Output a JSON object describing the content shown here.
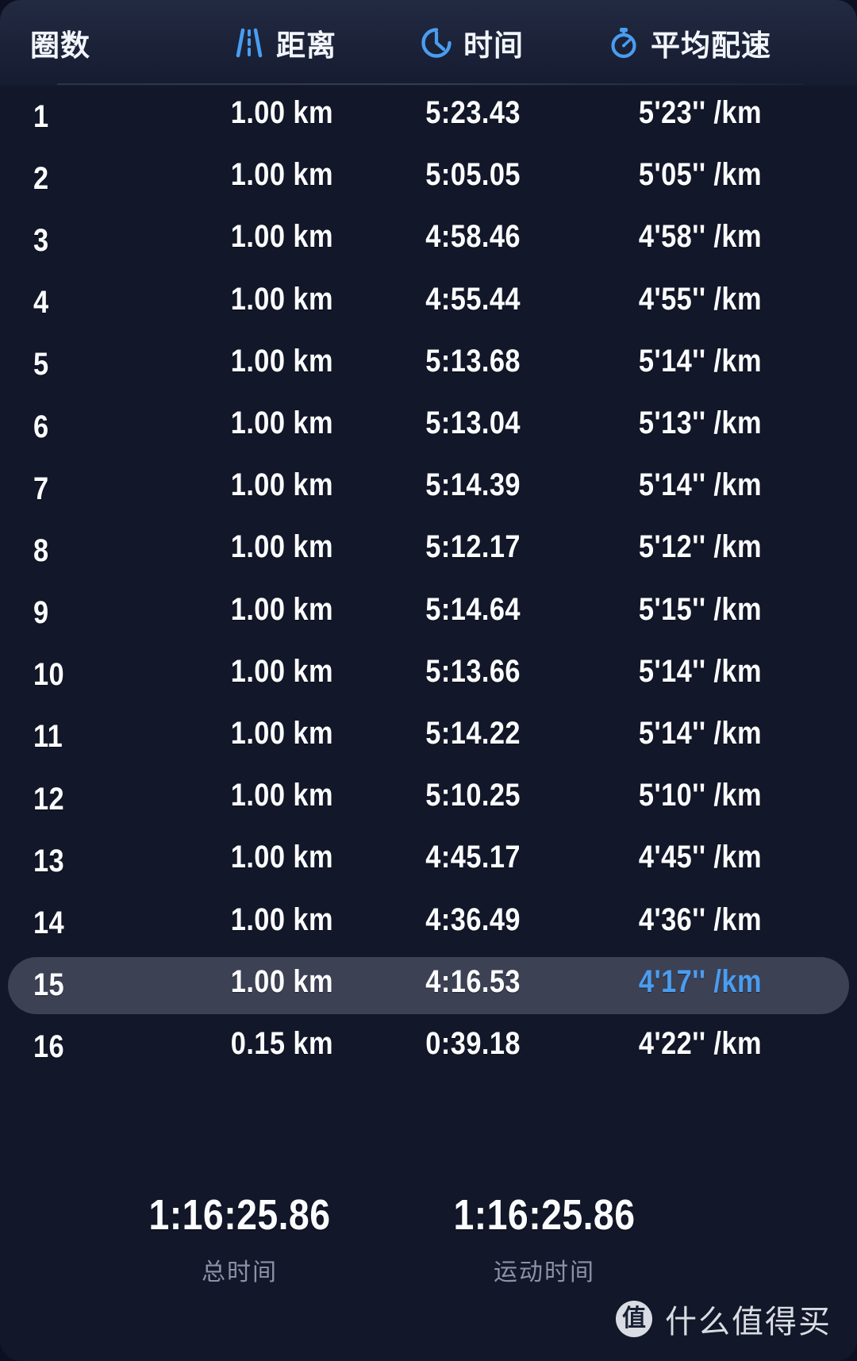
{
  "theme": {
    "background": "#121729",
    "header_gradient_top": "#222a42",
    "text_primary": "#fbfcfe",
    "text_muted": "#8a93a8",
    "accent": "#4a9df0",
    "highlight_row_bg": "#3d4154"
  },
  "header": {
    "columns": [
      {
        "label": "圈数",
        "icon": ""
      },
      {
        "label": "距离",
        "icon": "road-lane-icon"
      },
      {
        "label": "时间",
        "icon": "clock-icon"
      },
      {
        "label": "平均配速",
        "icon": "stopwatch-icon"
      }
    ]
  },
  "table": {
    "column_keys": [
      "lap",
      "distance",
      "time",
      "avg_pace"
    ],
    "rows": [
      {
        "lap": "1",
        "distance": "1.00 km",
        "time": "5:23.43",
        "avg_pace": "5'23'' /km",
        "highlighted": false
      },
      {
        "lap": "2",
        "distance": "1.00 km",
        "time": "5:05.05",
        "avg_pace": "5'05'' /km",
        "highlighted": false
      },
      {
        "lap": "3",
        "distance": "1.00 km",
        "time": "4:58.46",
        "avg_pace": "4'58'' /km",
        "highlighted": false
      },
      {
        "lap": "4",
        "distance": "1.00 km",
        "time": "4:55.44",
        "avg_pace": "4'55'' /km",
        "highlighted": false
      },
      {
        "lap": "5",
        "distance": "1.00 km",
        "time": "5:13.68",
        "avg_pace": "5'14'' /km",
        "highlighted": false
      },
      {
        "lap": "6",
        "distance": "1.00 km",
        "time": "5:13.04",
        "avg_pace": "5'13'' /km",
        "highlighted": false
      },
      {
        "lap": "7",
        "distance": "1.00 km",
        "time": "5:14.39",
        "avg_pace": "5'14'' /km",
        "highlighted": false
      },
      {
        "lap": "8",
        "distance": "1.00 km",
        "time": "5:12.17",
        "avg_pace": "5'12'' /km",
        "highlighted": false
      },
      {
        "lap": "9",
        "distance": "1.00 km",
        "time": "5:14.64",
        "avg_pace": "5'15'' /km",
        "highlighted": false
      },
      {
        "lap": "10",
        "distance": "1.00 km",
        "time": "5:13.66",
        "avg_pace": "5'14'' /km",
        "highlighted": false
      },
      {
        "lap": "11",
        "distance": "1.00 km",
        "time": "5:14.22",
        "avg_pace": "5'14'' /km",
        "highlighted": false
      },
      {
        "lap": "12",
        "distance": "1.00 km",
        "time": "5:10.25",
        "avg_pace": "5'10'' /km",
        "highlighted": false
      },
      {
        "lap": "13",
        "distance": "1.00 km",
        "time": "4:45.17",
        "avg_pace": "4'45'' /km",
        "highlighted": false
      },
      {
        "lap": "14",
        "distance": "1.00 km",
        "time": "4:36.49",
        "avg_pace": "4'36'' /km",
        "highlighted": false
      },
      {
        "lap": "15",
        "distance": "1.00 km",
        "time": "4:16.53",
        "avg_pace": "4'17'' /km",
        "highlighted": true
      },
      {
        "lap": "16",
        "distance": "0.15 km",
        "time": "0:39.18",
        "avg_pace": "4'22'' /km",
        "highlighted": false
      }
    ]
  },
  "summary": {
    "total": {
      "value": "1:16:25.86",
      "label": "总时间"
    },
    "active": {
      "value": "1:16:25.86",
      "label": "运动时间"
    }
  },
  "watermark": {
    "logo_glyph": "值",
    "text": "什么值得买"
  }
}
